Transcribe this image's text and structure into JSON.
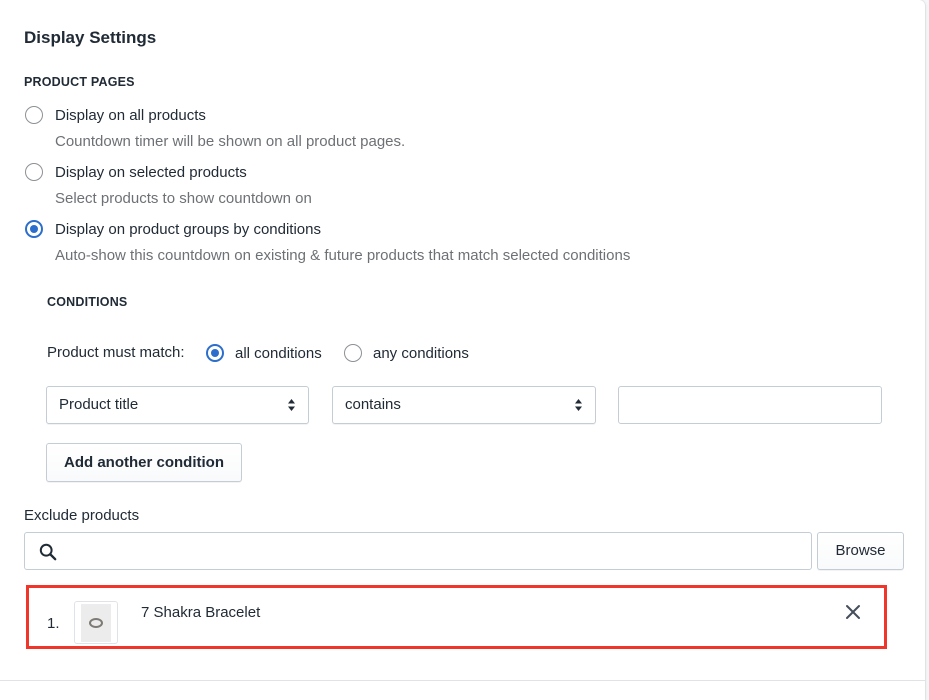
{
  "card": {
    "title": "Display Settings"
  },
  "product_pages": {
    "heading": "PRODUCT PAGES",
    "options": [
      {
        "label": "Display on all products",
        "help": "Countdown timer will be shown on all product pages.",
        "selected": false
      },
      {
        "label": "Display on selected products",
        "help": "Select products to show countdown on",
        "selected": false
      },
      {
        "label": "Display on product groups by conditions",
        "help": "Auto-show this countdown on existing & future products that match selected conditions",
        "selected": true
      }
    ]
  },
  "conditions": {
    "heading": "CONDITIONS",
    "match_label": "Product must match:",
    "match_options": [
      {
        "label": "all conditions",
        "selected": true
      },
      {
        "label": "any conditions",
        "selected": false
      }
    ],
    "field_select": "Product title",
    "operator_select": "contains",
    "value_input": "",
    "add_button": "Add another condition"
  },
  "exclude": {
    "label": "Exclude products",
    "search_placeholder": "",
    "browse_button": "Browse",
    "items": [
      {
        "index": "1.",
        "name": "7 Shakra Bracelet"
      }
    ]
  },
  "colors": {
    "accent": "#2c6ecb",
    "highlight_border": "#f0362b",
    "help_text": "#6d7175"
  },
  "icons": {
    "search": "search-icon",
    "remove": "close-icon",
    "select_arrows": "select-arrows-icon"
  }
}
